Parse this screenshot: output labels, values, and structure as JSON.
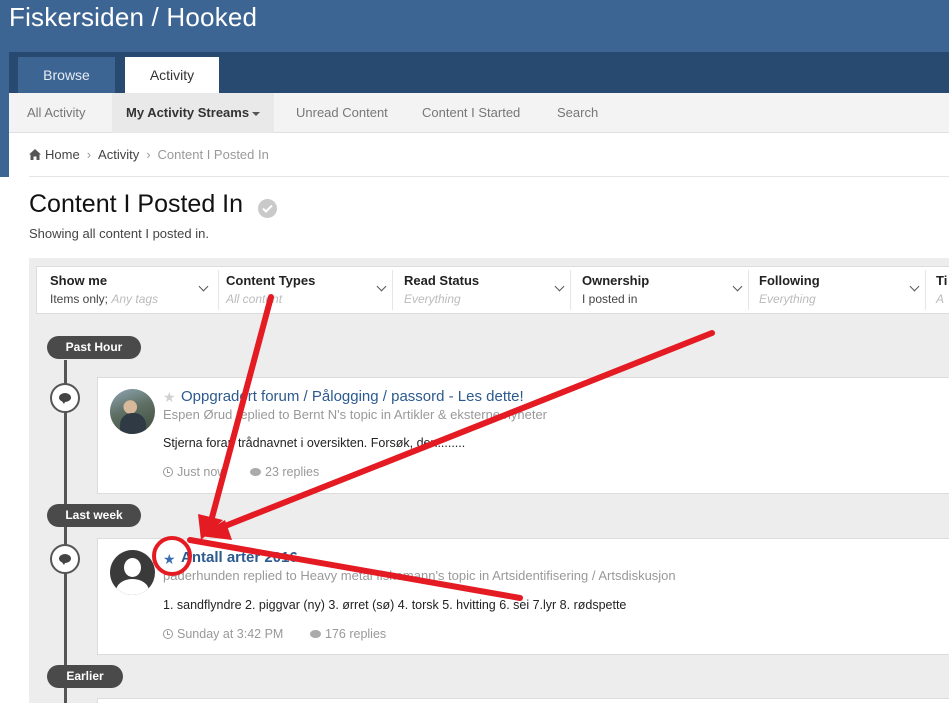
{
  "site": {
    "title": "Fiskersiden / Hooked"
  },
  "nav": {
    "tabs": [
      "Browse",
      "Activity"
    ]
  },
  "subnav": {
    "items": [
      "All Activity",
      "My Activity Streams",
      "Unread Content",
      "Content I Started",
      "Search"
    ]
  },
  "breadcrumb": {
    "home": "Home",
    "activity": "Activity",
    "current": "Content I Posted In"
  },
  "page": {
    "title": "Content I Posted In",
    "description": "Showing all content I posted in."
  },
  "filters": [
    {
      "title": "Show me",
      "value": "Items only;",
      "extra": "Any tags"
    },
    {
      "title": "Content Types",
      "value": "All content"
    },
    {
      "title": "Read Status",
      "value": "Everything"
    },
    {
      "title": "Ownership",
      "value": "I posted in"
    },
    {
      "title": "Following",
      "value": "Everything"
    },
    {
      "title": "Ti",
      "value": "A"
    }
  ],
  "timeline": {
    "groups": [
      "Past Hour",
      "Last week",
      "Earlier"
    ],
    "items": [
      {
        "title": "Oppgradert forum / Pålogging / passord - Les dette!",
        "meta": "Espen Ørud replied to Bernt N's topic in Artikler & eksterne nyheter",
        "snippet": "Stjerna foran trådnavnet i oversikten. Forsøk, den........",
        "time": "Just now",
        "replies": "23 replies",
        "followed": false
      },
      {
        "title": "Antall arter 2016",
        "meta": "paderhunden replied to Heavy metal fiskemann's topic in Artsidentifisering / Artsdiskusjon",
        "snippet": "1. sandflyndre 2. piggvar (ny) 3. ørret (sø) 4. torsk 5. hvitting 6. sei 7.lyr 8. rødspette",
        "time": "Sunday at 3:42 PM",
        "replies": "176 replies",
        "followed": true
      }
    ]
  },
  "colors": {
    "header": "#3d6594",
    "nav_bar": "#284a70",
    "link": "#2c5a8f",
    "annotation_red": "#e41b23",
    "star_followed": "#3a6eb0",
    "star_unfollowed": "#d0d0d0"
  }
}
